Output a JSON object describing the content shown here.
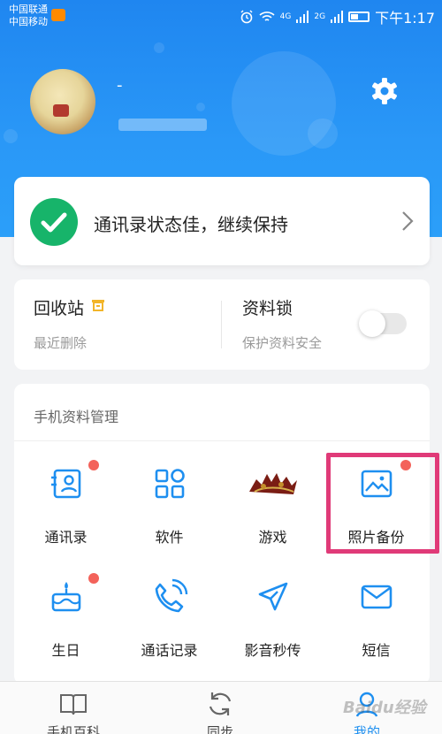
{
  "statusbar": {
    "carrier1": "中国联通",
    "carrier2": "中国移动",
    "network1": "4G",
    "network2": "2G",
    "time": "下午1:17"
  },
  "profile": {
    "username": "-"
  },
  "status_card": {
    "text": "通讯录状态佳，继续保持"
  },
  "tools": {
    "recycle_title": "回收站",
    "recycle_sub": "最近删除",
    "lock_title": "资料锁",
    "lock_sub": "保护资料安全",
    "lock_enabled": false
  },
  "manage": {
    "title": "手机资料管理",
    "items": [
      {
        "label": "通讯录",
        "icon": "contacts-icon",
        "badge": true
      },
      {
        "label": "软件",
        "icon": "apps-icon",
        "badge": false
      },
      {
        "label": "游戏",
        "icon": "game-logo-icon",
        "badge": false
      },
      {
        "label": "照片备份",
        "icon": "photo-icon",
        "badge": true,
        "highlighted": true
      },
      {
        "label": "生日",
        "icon": "birthday-cake-icon",
        "badge": true
      },
      {
        "label": "通话记录",
        "icon": "phone-icon",
        "badge": false
      },
      {
        "label": "影音秒传",
        "icon": "send-icon",
        "badge": false
      },
      {
        "label": "短信",
        "icon": "mail-icon",
        "badge": false
      }
    ]
  },
  "nav": {
    "items": [
      {
        "label": "手机百科",
        "icon": "book-icon"
      },
      {
        "label": "同步",
        "icon": "sync-icon"
      },
      {
        "label": "我的",
        "icon": "profile-icon",
        "active": true
      }
    ]
  },
  "watermark": "Baidu经验",
  "colors": {
    "brand_blue": "#2a98f7",
    "success_green": "#17b46a",
    "badge_red": "#f3625a",
    "highlight_pink": "#e03a78",
    "icon_blue": "#1e8ff0"
  }
}
